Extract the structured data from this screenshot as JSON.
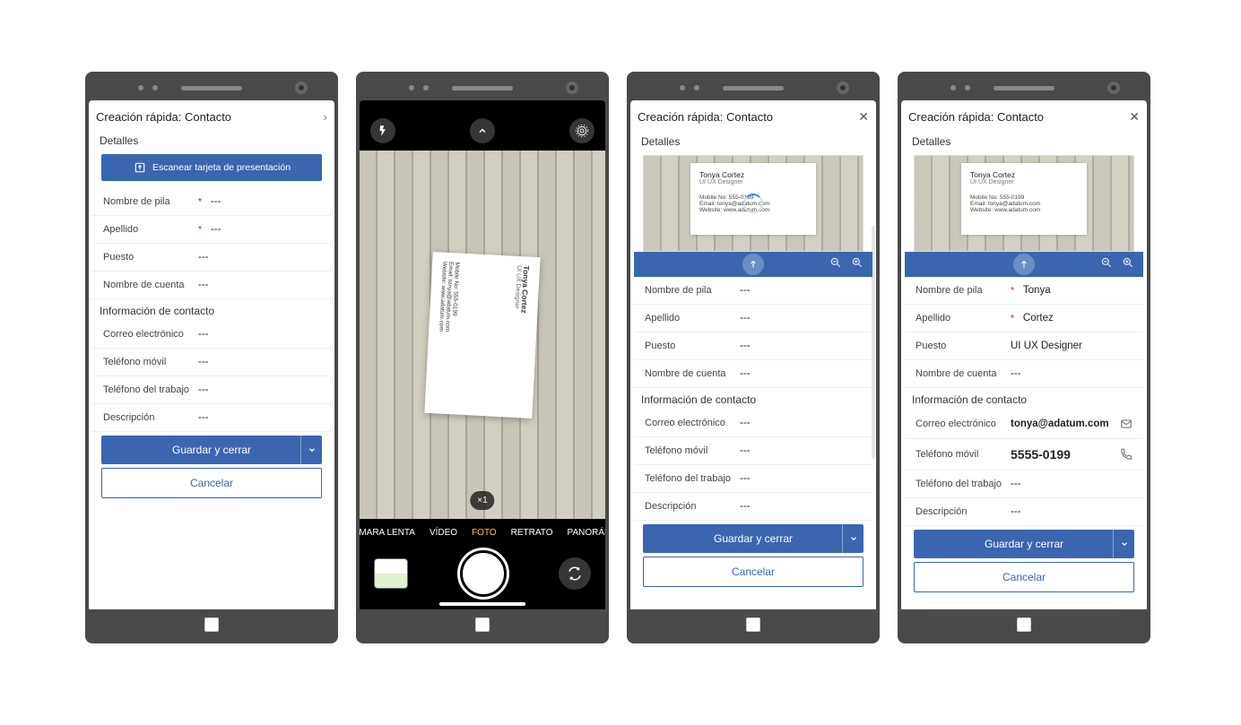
{
  "app_title": "Creación rápida: Contacto",
  "sections": {
    "details": "Detalles",
    "contact_info": "Información de contacto"
  },
  "scan_button": "Escanear tarjeta de presentación",
  "fields": {
    "first_name": "Nombre de pila",
    "last_name": "Apellido",
    "job_title": "Puesto",
    "account": "Nombre de cuenta",
    "email": "Correo electrónico",
    "mobile": "Teléfono móvil",
    "work_phone": "Teléfono del trabajo",
    "description": "Descripción"
  },
  "placeholder": "---",
  "buttons": {
    "save_close": "Guardar y cerrar",
    "cancel": "Cancelar"
  },
  "camera": {
    "zoom": "×1",
    "modes": [
      "ÁMARA LENTA",
      "VÍDEO",
      "FOTO",
      "RETRATO",
      "PANORÁM"
    ]
  },
  "business_card": {
    "name": "Tonya Cortez",
    "title": "UI UX Designer",
    "mobile_line": "Mobile No: 555-0199",
    "email_line": "Email: tonya@adatum.com",
    "website_line": "Website: www.adatum.com"
  },
  "panel4_values": {
    "first_name": "Tonya",
    "last_name": "Cortez",
    "job_title": "UI UX Designer",
    "account": "---",
    "email": "tonya@adatum.com",
    "mobile": "5555-0199",
    "work_phone": "---",
    "description": "---"
  }
}
